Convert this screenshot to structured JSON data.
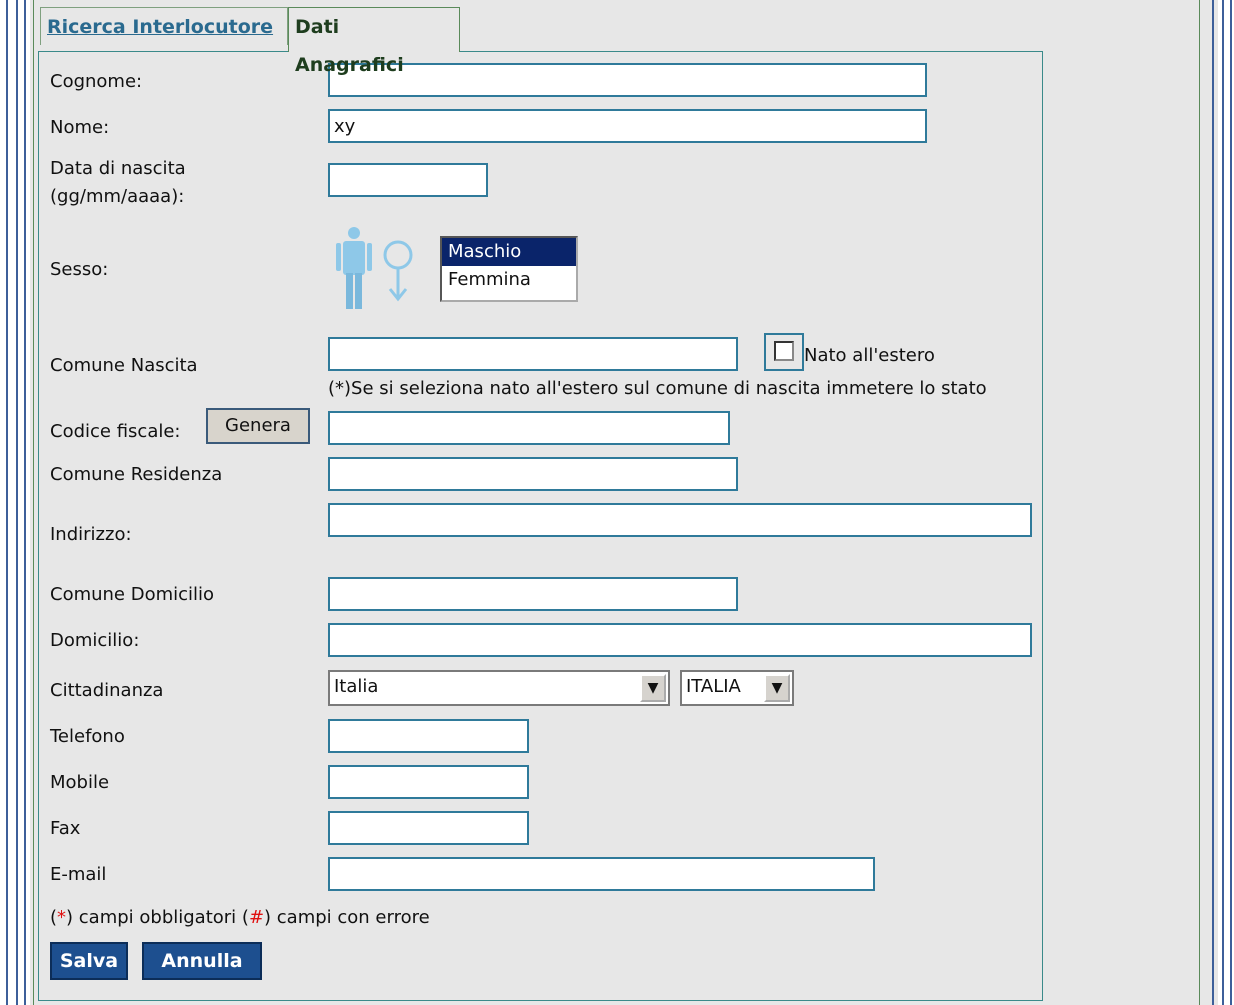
{
  "tabs": {
    "inactive": "Ricerca Interlocutore",
    "active": "Dati Anagrafici"
  },
  "form": {
    "cognome_label": "Cognome:",
    "cognome_value": "",
    "nome_label": "Nome:",
    "nome_value": "xy",
    "data_nascita_label_1": "Data di nascita",
    "data_nascita_label_2": "(gg/mm/aaaa):",
    "sesso_label": "Sesso:",
    "sesso_options": [
      "Maschio",
      "Femmina"
    ],
    "sesso_selected": "Maschio",
    "comune_nascita_label": "Comune Nascita",
    "nato_estero_label": "Nato all'estero",
    "nato_estero_note": "(*)Se si seleziona nato all'estero sul comune di nascita immetere lo stato",
    "codice_fiscale_label": "Codice fiscale:",
    "genera_button": "Genera",
    "comune_residenza_label": "Comune Residenza",
    "indirizzo_label": "Indirizzo:",
    "comune_domicilio_label": "Comune Domicilio",
    "domicilio_label": "Domicilio:",
    "cittadinanza_label": "Cittadinanza",
    "cittadinanza_value": "Italia",
    "cittadinanza_code": "ITALIA",
    "telefono_label": "Telefono",
    "mobile_label": "Mobile",
    "fax_label": "Fax",
    "email_label": "E-mail"
  },
  "legend": {
    "open1": "(",
    "star": "*",
    "text1": ") campi obbligatori (",
    "hash": "#",
    "text2": ") campi con errore"
  },
  "buttons": {
    "save": "Salva",
    "cancel": "Annulla"
  },
  "icons": {
    "male": "male-figure-icon",
    "female": "female-symbol-icon"
  },
  "colors": {
    "accent": "#1d4f8f",
    "selection": "#0a246a",
    "link": "#2a6a8f",
    "input_border": "#2f7a9a"
  }
}
